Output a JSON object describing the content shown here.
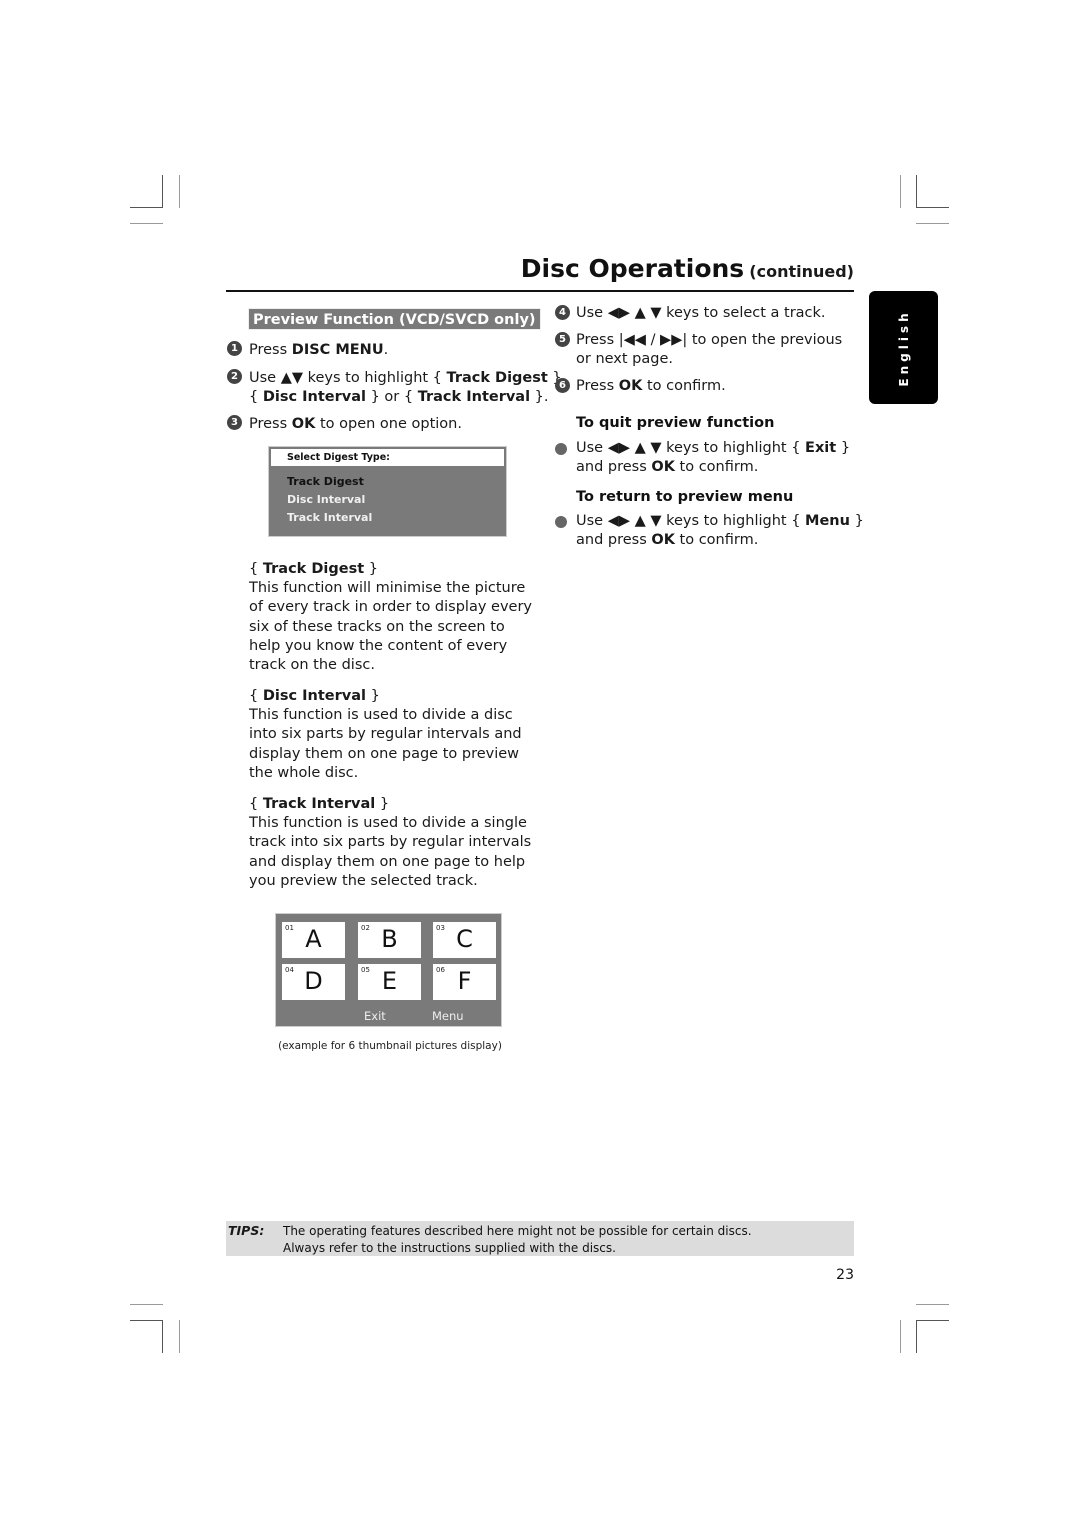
{
  "header": {
    "title": "Disc Operations",
    "title_suffix": "(continued)"
  },
  "language_tab": "English",
  "section": {
    "heading": "Preview Function (VCD/SVCD only)"
  },
  "steps_left": [
    {
      "num": "1",
      "pre": "Press ",
      "bold": "DISC MENU",
      "post": "."
    },
    {
      "num": "2",
      "line1_pre": "Use ▲▼ keys to highlight { ",
      "line1_bold": "Track Digest",
      "line1_post": " },",
      "line2_a": "{ ",
      "line2_bold1": "Disc Interval",
      "line2_b": " } or { ",
      "line2_bold2": "Track Interval",
      "line2_c": " }."
    },
    {
      "num": "3",
      "pre": "Press ",
      "bold": "OK",
      "post": " to open one option."
    }
  ],
  "digest_menu": {
    "header": "Select Digest Type:",
    "options": [
      {
        "label": "Track Digest",
        "color": "#111111"
      },
      {
        "label": "Disc Interval",
        "color": "#f0f0f0"
      },
      {
        "label": "Track Interval",
        "color": "#f0f0f0"
      }
    ]
  },
  "descriptions": [
    {
      "title": "Track Digest",
      "text": "This function will minimise the picture of every track in order to display every six of these tracks on the screen to help you know the content of every track on the disc."
    },
    {
      "title": "Disc Interval",
      "text": "This function is used to divide a disc into six parts by regular intervals and display them on one page to preview the whole disc."
    },
    {
      "title": "Track Interval",
      "text": "This function is used to divide a single track into six parts by regular intervals and display them on one page to help you preview the selected track."
    }
  ],
  "thumbnail_preview": {
    "thumbs": [
      {
        "num": "01",
        "letter": "A"
      },
      {
        "num": "02",
        "letter": "B"
      },
      {
        "num": "03",
        "letter": "C"
      },
      {
        "num": "04",
        "letter": "D"
      },
      {
        "num": "05",
        "letter": "E"
      },
      {
        "num": "06",
        "letter": "F"
      }
    ],
    "exit_label": "Exit",
    "menu_label": "Menu",
    "caption": "(example for 6 thumbnail pictures display)"
  },
  "steps_right": [
    {
      "num": "4",
      "text": "Use ◀▶ ▲ ▼ keys to select a track."
    },
    {
      "num": "5",
      "line1": "Press |◀◀ / ▶▶| to open the previous",
      "line2": "or next page."
    },
    {
      "num": "6",
      "pre": "Press ",
      "bold": "OK",
      "post": " to confirm."
    }
  ],
  "quit_preview": {
    "heading": "To quit preview function",
    "line1_pre": "Use ◀▶ ▲ ▼ keys to highlight { ",
    "line1_bold": "Exit",
    "line1_post": " }",
    "line2_pre": "and press ",
    "line2_bold": "OK",
    "line2_post": " to confirm."
  },
  "return_preview": {
    "heading": "To return to preview menu",
    "line1_pre": "Use ◀▶ ▲ ▼ keys to highlight { ",
    "line1_bold": "Menu",
    "line1_post": " }",
    "line2_pre": "and press ",
    "line2_bold": "OK",
    "line2_post": " to confirm."
  },
  "tips": {
    "label": "TIPS:",
    "line1": "The operating features described here might not be possible for certain discs.",
    "line2": "Always refer to the instructions supplied with the discs."
  },
  "page_number": "23"
}
